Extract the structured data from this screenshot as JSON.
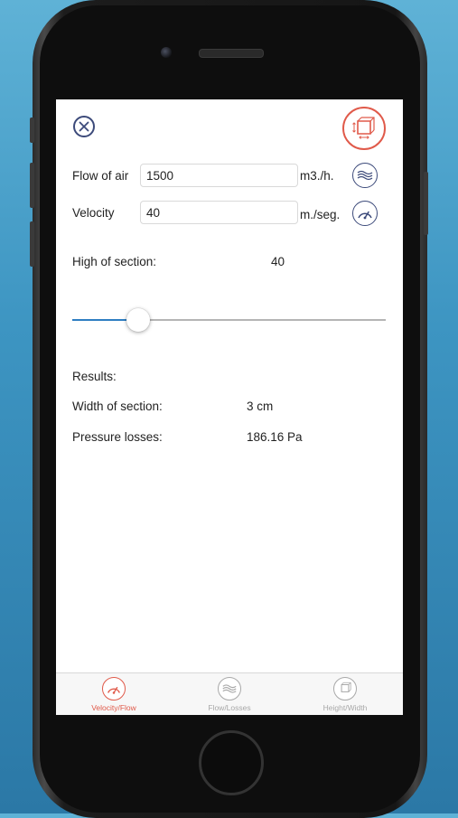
{
  "header": {
    "close_icon": "close-icon",
    "mode_icon": "section-dimension-icon",
    "accent_color": "#e05a4a"
  },
  "form": {
    "flow": {
      "label": "Flow of air",
      "value": "1500",
      "unit": "m3./h.",
      "icon": "airflow-icon"
    },
    "velocity": {
      "label": "Velocity",
      "value": "40",
      "unit": "m./seg.",
      "icon": "gauge-icon"
    }
  },
  "height": {
    "label": "High of section:",
    "value": "40"
  },
  "slider": {
    "level_fraction": 0.21,
    "active_color": "#2f7ec2"
  },
  "results": {
    "title": "Results:",
    "width": {
      "label": "Width of section:",
      "value": "3 cm"
    },
    "pressure": {
      "label": "Pressure losses:",
      "value": "186.16 Pa"
    }
  },
  "tabs": [
    {
      "label": "Velocity/Flow",
      "icon": "gauge-icon",
      "active": true
    },
    {
      "label": "Flow/Losses",
      "icon": "airflow-icon",
      "active": false
    },
    {
      "label": "Height/Width",
      "icon": "section-dimension-icon",
      "active": false
    }
  ],
  "colors": {
    "active_tab": "#e05a4a",
    "inactive_tab": "#a8a8a8",
    "icon_stroke": "#3c4a7a"
  }
}
